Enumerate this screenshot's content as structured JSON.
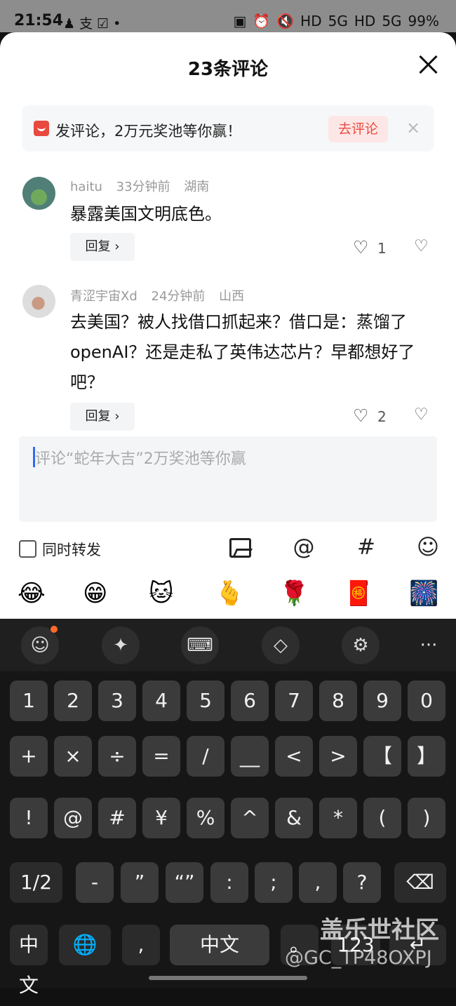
{
  "status": {
    "time": "21:54",
    "left_icons": "♟ 支 ☑ •",
    "right_icons": [
      "▣",
      "⏰",
      "🔇",
      "HD",
      "5G",
      "HD",
      "5G"
    ],
    "battery": "99%"
  },
  "sheet": {
    "title": "23条评论"
  },
  "banner": {
    "text": "发评论，2万元奖池等你赢！",
    "button": "去评论"
  },
  "comments": [
    {
      "username": "haitu",
      "time": "33分钟前",
      "region": "湖南",
      "text": "暴露美国文明底色。",
      "reply_label": "回复 ›",
      "likes": "1"
    },
    {
      "username": "青涩宇宙Xd",
      "time": "24分钟前",
      "region": "山西",
      "text": "去美国？被人找借口抓起来？借口是：蒸馏了openAI？还是走私了英伟达芯片？早都想好了吧？",
      "reply_label": "回复 ›",
      "likes": "2"
    }
  ],
  "composer": {
    "placeholder": "评论“蛇年大吉”2万奖池等你赢",
    "forward_label": "同时转发"
  },
  "tools": {
    "at": "@",
    "hashtag": "#",
    "emoji": "☺"
  },
  "emoji_bar": [
    "😂",
    "😁",
    "🐱",
    "🫰",
    "🌹",
    "🧧",
    "🎆"
  ],
  "keyboard_toolbar": [
    "☺",
    "✦",
    "⌨",
    "◇",
    "⚙",
    "···"
  ],
  "keys": {
    "row1": [
      "1",
      "2",
      "3",
      "4",
      "5",
      "6",
      "7",
      "8",
      "9",
      "0"
    ],
    "row2": [
      "+",
      "×",
      "÷",
      "=",
      "/",
      "__",
      "<",
      ">",
      "【",
      "】"
    ],
    "row3": [
      "!",
      "@",
      "#",
      "¥",
      "%",
      "^",
      "&",
      "*",
      "(",
      ")"
    ],
    "row4": [
      "1/2",
      "-",
      "”",
      "“”",
      ":",
      ";",
      ",",
      "?",
      "⌫"
    ],
    "row5": [
      "中文",
      "🌐",
      ",",
      "中文",
      "。",
      "123",
      "↵"
    ]
  },
  "watermark": {
    "line1": "盖乐世社区",
    "line2": "@GC_TP48OXPJ"
  }
}
